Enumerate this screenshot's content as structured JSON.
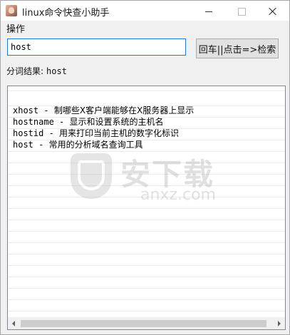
{
  "window": {
    "title": "linux命令快查小助手",
    "icon": "app-avatar-icon"
  },
  "menu": {
    "items": [
      "操作"
    ]
  },
  "search": {
    "value": "host",
    "button_label": "回车||点击=>检索"
  },
  "segmentation": {
    "label": "分词结果:",
    "value": "host"
  },
  "results": [
    {
      "name": "xhost",
      "sep": " - ",
      "desc": "制哪些X客户端能够在X服务器上显示"
    },
    {
      "name": "hostname",
      "sep": " - ",
      "desc": "显示和设置系统的主机名"
    },
    {
      "name": "hostid",
      "sep": " - ",
      "desc": "用来打印当前主机的数字化标识"
    },
    {
      "name": "host",
      "sep": " - ",
      "desc": "常用的分析域名查询工具"
    }
  ],
  "watermark": {
    "text_cn": "安下载",
    "text_en": "anxz.com"
  }
}
